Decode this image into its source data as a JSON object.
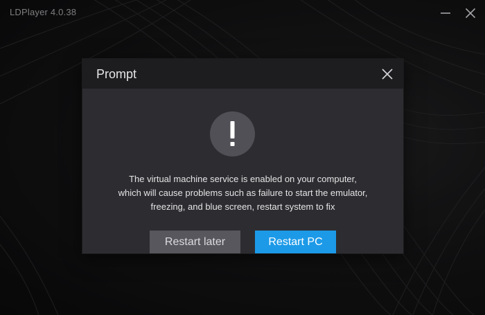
{
  "app": {
    "title": "LDPlayer 4.0.38",
    "minimize_icon": "minimize-icon",
    "close_icon": "close-icon"
  },
  "dialog": {
    "title": "Prompt",
    "close_icon": "close-icon",
    "alert_icon": "exclamation-icon",
    "alert_symbol": "!",
    "message_lines": [
      "The virtual machine service is enabled on your computer,",
      "which will cause problems such as failure to start the emulator,",
      "freezing, and blue screen, restart system to fix"
    ],
    "buttons": {
      "restart_later": "Restart later",
      "restart_pc": "Restart PC"
    }
  },
  "colors": {
    "primary_button": "#1c9ae8",
    "secondary_button": "#57575d",
    "dialog_body": "#2d2d31",
    "dialog_header": "#1d1d20",
    "alert_circle": "#505056"
  }
}
